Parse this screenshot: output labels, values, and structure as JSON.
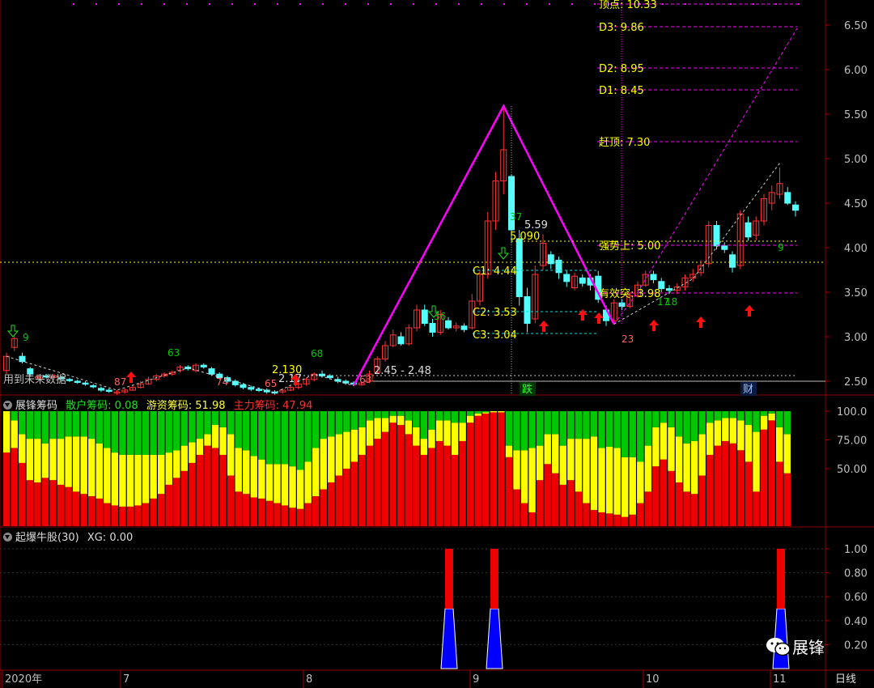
{
  "colors": {
    "up": "#ff3232",
    "down": "#54ffff",
    "magenta": "#ff00ff",
    "yellow": "#ffff00",
    "green": "#00cc00",
    "red": "#ee0000",
    "blue": "#0000ff",
    "grid": "#555555",
    "axis_text": "#c0c0c0"
  },
  "main_panel": {
    "price_ticks": [
      "6.50",
      "6.00",
      "5.50",
      "5.00",
      "4.50",
      "4.00",
      "3.50",
      "3.00",
      "2.50"
    ],
    "future_data_label": "用到未来数据",
    "level_labels": {
      "partial_top": "顶点: 10.33",
      "d3": "D3: 9.86",
      "d2": "D2: 8.95",
      "d1": "D1: 8.45",
      "catch_top": "赶顶: 7.30",
      "strong_up": "强势上: 5.00",
      "effective_break": "有效突: 3.98",
      "c1": "C1: 4.44",
      "c2": "C2: 3.53",
      "c3": "C3: 3.04",
      "peak_price": "5.59",
      "peak_level": "5.090",
      "range_low": "2.45 - 2.48",
      "low_price_1": "2.130",
      "low_price_2": "2.17"
    },
    "counts": [
      "9",
      "87",
      "63",
      "74",
      "65",
      "68",
      "63",
      "36",
      "37",
      "23",
      "17",
      "18",
      "9"
    ],
    "badges": {
      "die": "跌",
      "cai": "财"
    }
  },
  "chip_panel": {
    "title": "展锋筹码",
    "retail_label": "散户筹码: 0.08",
    "hot_label": "游资筹码: 51.98",
    "main_label": "主力筹码: 47.94",
    "ticks": [
      "100.0",
      "75.00",
      "50.00"
    ]
  },
  "signal_panel": {
    "title": "起爆牛股(30)",
    "xg_label": "XG: 0.00",
    "ticks": [
      "1.00",
      "0.80",
      "0.60",
      "0.40",
      "0.20"
    ]
  },
  "time_axis": {
    "labels": [
      "2020年",
      "7",
      "8",
      "9",
      "10",
      "11"
    ],
    "period": "日线"
  },
  "watermark": {
    "brand": "展锋",
    "icon": "wechat-icon"
  },
  "chart_data": [
    {
      "type": "candlestick",
      "title": "",
      "y_ticks": [
        2.5,
        3.0,
        3.5,
        4.0,
        4.5,
        5.0,
        5.5,
        6.0,
        6.5
      ],
      "candles": [
        [
          2.62,
          2.78,
          2.58,
          2.82
        ],
        [
          2.88,
          2.98,
          2.84,
          3.02
        ],
        [
          2.78,
          2.72,
          2.7,
          2.82
        ],
        [
          2.64,
          2.58,
          2.55,
          2.66
        ],
        [
          2.54,
          2.55,
          2.52,
          2.58
        ],
        [
          2.56,
          2.55,
          2.54,
          2.58
        ],
        [
          2.54,
          2.56,
          2.52,
          2.58
        ],
        [
          2.54,
          2.53,
          2.5,
          2.56
        ],
        [
          2.52,
          2.51,
          2.49,
          2.54
        ],
        [
          2.5,
          2.49,
          2.47,
          2.52
        ],
        [
          2.48,
          2.47,
          2.45,
          2.5
        ],
        [
          2.45,
          2.44,
          2.42,
          2.47
        ],
        [
          2.42,
          2.4,
          2.38,
          2.44
        ],
        [
          2.4,
          2.39,
          2.37,
          2.42
        ],
        [
          2.38,
          2.38,
          2.35,
          2.4
        ],
        [
          2.38,
          2.4,
          2.36,
          2.42
        ],
        [
          2.4,
          2.43,
          2.39,
          2.45
        ],
        [
          2.43,
          2.47,
          2.42,
          2.5
        ],
        [
          2.47,
          2.52,
          2.46,
          2.55
        ],
        [
          2.52,
          2.56,
          2.5,
          2.58
        ],
        [
          2.56,
          2.58,
          2.54,
          2.6
        ],
        [
          2.58,
          2.6,
          2.56,
          2.62
        ],
        [
          2.62,
          2.66,
          2.6,
          2.68
        ],
        [
          2.66,
          2.64,
          2.62,
          2.68
        ],
        [
          2.62,
          2.68,
          2.6,
          2.7
        ],
        [
          2.68,
          2.66,
          2.64,
          2.7
        ],
        [
          2.64,
          2.58,
          2.56,
          2.66
        ],
        [
          2.58,
          2.54,
          2.52,
          2.6
        ],
        [
          2.54,
          2.5,
          2.48,
          2.56
        ],
        [
          2.5,
          2.46,
          2.44,
          2.52
        ],
        [
          2.46,
          2.43,
          2.41,
          2.48
        ],
        [
          2.43,
          2.41,
          2.39,
          2.45
        ],
        [
          2.41,
          2.4,
          2.38,
          2.43
        ],
        [
          2.4,
          2.38,
          2.36,
          2.42
        ],
        [
          2.38,
          2.37,
          2.35,
          2.4
        ],
        [
          2.38,
          2.4,
          2.36,
          2.42
        ],
        [
          2.4,
          2.43,
          2.39,
          2.45
        ],
        [
          2.43,
          2.47,
          2.41,
          2.49
        ],
        [
          2.47,
          2.52,
          2.45,
          2.54
        ],
        [
          2.52,
          2.58,
          2.5,
          2.6
        ],
        [
          2.58,
          2.56,
          2.54,
          2.62
        ],
        [
          2.56,
          2.54,
          2.52,
          2.58
        ],
        [
          2.52,
          2.5,
          2.48,
          2.55
        ],
        [
          2.5,
          2.48,
          2.46,
          2.52
        ],
        [
          2.48,
          2.47,
          2.46,
          2.5
        ],
        [
          2.46,
          2.48,
          2.45,
          2.5
        ],
        [
          2.5,
          2.58,
          2.48,
          2.62
        ],
        [
          2.6,
          2.75,
          2.58,
          2.78
        ],
        [
          2.75,
          2.9,
          2.72,
          2.95
        ],
        [
          2.9,
          3.02,
          2.88,
          3.08
        ],
        [
          3.0,
          2.92,
          2.9,
          3.05
        ],
        [
          2.92,
          3.1,
          2.9,
          3.14
        ],
        [
          3.1,
          3.3,
          3.06,
          3.36
        ],
        [
          3.3,
          3.15,
          3.12,
          3.36
        ],
        [
          3.15,
          3.05,
          3.0,
          3.2
        ],
        [
          3.05,
          3.25,
          3.02,
          3.3
        ],
        [
          3.18,
          3.1,
          3.08,
          3.22
        ],
        [
          3.1,
          3.12,
          3.06,
          3.16
        ],
        [
          3.12,
          3.08,
          3.05,
          3.15
        ],
        [
          3.1,
          3.4,
          3.08,
          3.48
        ],
        [
          3.4,
          3.7,
          3.35,
          3.75
        ],
        [
          3.7,
          4.3,
          3.65,
          4.4
        ],
        [
          4.3,
          4.75,
          4.2,
          4.85
        ],
        [
          4.75,
          5.1,
          4.6,
          5.59
        ],
        [
          4.8,
          4.2,
          4.05,
          4.82
        ],
        [
          4.1,
          3.45,
          3.35,
          4.2
        ],
        [
          3.45,
          3.15,
          3.05,
          3.55
        ],
        [
          3.2,
          3.7,
          3.15,
          3.8
        ],
        [
          3.8,
          4.05,
          3.75,
          4.15
        ],
        [
          3.92,
          3.82,
          3.76,
          3.96
        ],
        [
          3.86,
          3.72,
          3.65,
          3.9
        ],
        [
          3.7,
          3.62,
          3.56,
          3.74
        ],
        [
          3.55,
          3.68,
          3.52,
          3.72
        ],
        [
          3.66,
          3.6,
          3.56,
          3.7
        ],
        [
          3.66,
          3.58,
          3.52,
          3.7
        ],
        [
          3.68,
          3.42,
          3.38,
          3.74
        ],
        [
          3.3,
          3.18,
          3.12,
          3.35
        ],
        [
          3.18,
          3.38,
          3.14,
          3.42
        ],
        [
          3.38,
          3.34,
          3.3,
          3.42
        ],
        [
          3.34,
          3.46,
          3.32,
          3.5
        ],
        [
          3.46,
          3.58,
          3.44,
          3.62
        ],
        [
          3.58,
          3.7,
          3.56,
          3.74
        ],
        [
          3.7,
          3.64,
          3.6,
          3.74
        ],
        [
          3.62,
          3.54,
          3.5,
          3.66
        ],
        [
          3.54,
          3.52,
          3.48,
          3.58
        ],
        [
          3.52,
          3.56,
          3.48,
          3.6
        ],
        [
          3.56,
          3.66,
          3.52,
          3.7
        ],
        [
          3.66,
          3.7,
          3.62,
          3.76
        ],
        [
          3.72,
          3.8,
          3.68,
          3.86
        ],
        [
          3.82,
          4.25,
          3.78,
          4.3
        ],
        [
          4.25,
          4.02,
          3.98,
          4.3
        ],
        [
          4.02,
          3.98,
          3.94,
          4.06
        ],
        [
          3.92,
          3.78,
          3.72,
          3.96
        ],
        [
          3.8,
          4.38,
          3.76,
          4.42
        ],
        [
          4.28,
          4.12,
          4.08,
          4.35
        ],
        [
          4.14,
          4.3,
          4.08,
          4.35
        ],
        [
          4.3,
          4.55,
          4.25,
          4.6
        ],
        [
          4.5,
          4.62,
          4.42,
          4.7
        ],
        [
          4.6,
          4.72,
          4.55,
          4.9
        ],
        [
          4.62,
          4.5,
          4.48,
          4.68
        ],
        [
          4.48,
          4.42,
          4.35,
          4.52
        ]
      ],
      "levels": {
        "d3": 9.86,
        "d2": 8.95,
        "d1": 8.45,
        "catch_top": 7.3,
        "strong_up": 5.0,
        "effective_break": 3.98,
        "c1": 4.44,
        "c2": 3.53,
        "c3": 3.04,
        "peak": 5.59,
        "peak_level": 5.09,
        "range_low": 2.45,
        "dashed_long": 4.65
      }
    },
    {
      "type": "bar",
      "title": "",
      "ylim": [
        0,
        100
      ],
      "series": [
        {
          "name": "散户筹码"
        },
        {
          "name": "游资筹码"
        },
        {
          "name": "主力筹码"
        }
      ],
      "red": [
        64,
        68,
        55,
        40,
        38,
        42,
        40,
        36,
        34,
        30,
        28,
        26,
        24,
        20,
        18,
        17,
        17,
        18,
        20,
        24,
        28,
        36,
        42,
        48,
        55,
        62,
        70,
        68,
        62,
        44,
        30,
        28,
        25,
        24,
        22,
        20,
        18,
        16,
        15,
        20,
        26,
        32,
        38,
        44,
        50,
        56,
        62,
        70,
        76,
        82,
        90,
        88,
        80,
        70,
        62,
        68,
        74,
        70,
        62,
        74,
        90,
        96,
        98,
        99,
        99,
        60,
        32,
        20,
        12,
        40,
        54,
        46,
        36,
        40,
        30,
        20,
        14,
        12,
        11,
        10,
        8,
        10,
        20,
        30,
        52,
        58,
        48,
        38,
        30,
        28,
        44,
        62,
        70,
        74,
        72,
        66,
        56,
        30,
        84,
        92,
        56,
        46
      ],
      "yellow": [
        36,
        24,
        25,
        36,
        38,
        30,
        36,
        40,
        44,
        48,
        50,
        50,
        48,
        48,
        46,
        45,
        45,
        44,
        42,
        38,
        34,
        28,
        24,
        22,
        18,
        14,
        10,
        20,
        24,
        36,
        38,
        38,
        36,
        34,
        32,
        34,
        36,
        36,
        34,
        36,
        42,
        44,
        40,
        36,
        32,
        28,
        24,
        22,
        18,
        12,
        6,
        8,
        12,
        16,
        14,
        16,
        18,
        22,
        28,
        16,
        6,
        2,
        1,
        1,
        1,
        10,
        34,
        46,
        56,
        30,
        26,
        34,
        34,
        36,
        46,
        56,
        64,
        56,
        58,
        58,
        52,
        50,
        36,
        40,
        34,
        32,
        38,
        40,
        42,
        46,
        36,
        28,
        22,
        20,
        22,
        26,
        32,
        52,
        12,
        6,
        30,
        34
      ]
    },
    {
      "type": "bar",
      "title": "",
      "ylim": [
        0,
        1
      ],
      "x": [
        49,
        53,
        86
      ],
      "values": [
        1,
        1,
        1
      ],
      "split": 0.5
    }
  ]
}
